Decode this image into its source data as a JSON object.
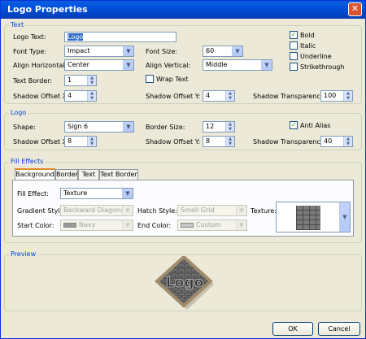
{
  "window": {
    "title": "Logo Properties",
    "close_glyph": "✕"
  },
  "text_group": {
    "label": "Text",
    "logo_text_label": "Logo Text:",
    "logo_text_value": "Logo",
    "font_type_label": "Font Type:",
    "font_type_value": "Impact",
    "font_size_label": "Font Size:",
    "font_size_value": "60",
    "align_horizontal_label": "Align Horizontal:",
    "align_horizontal_value": "Center",
    "align_vertical_label": "Align Vertical:",
    "align_vertical_value": "Middle",
    "text_border_label": "Text Border:",
    "text_border_value": "1",
    "wrap_text_label": "Wrap Text",
    "wrap_text_checked": false,
    "shadow_offset_x_label": "Shadow Offset X:",
    "shadow_offset_x_value": "4",
    "shadow_offset_y_label": "Shadow Offset Y:",
    "shadow_offset_y_value": "4",
    "shadow_transparency_label": "Shadow Transparency:",
    "shadow_transparency_value": "100",
    "bold_label": "Bold",
    "bold_checked": true,
    "italic_label": "Italic",
    "underline_label": "Underline",
    "strikethrough_label": "Strikethrough",
    "check_glyph": "✓"
  },
  "logo_group": {
    "label": "Logo",
    "shape_label": "Shape:",
    "shape_value": "Sign 6",
    "border_size_label": "Border Size:",
    "border_size_value": "12",
    "anti_alias_label": "Anti Alias",
    "anti_alias_checked": true,
    "shadow_offset_x_label": "Shadow Offset X:",
    "shadow_offset_x_value": "8",
    "shadow_offset_y_label": "Shadow Offset Y:",
    "shadow_offset_y_value": "8",
    "shadow_transparency_label": "Shadow Transparency:",
    "shadow_transparency_value": "40"
  },
  "fill_effects": {
    "label": "Fill Effects",
    "tabs": [
      "Background",
      "Border",
      "Text",
      "Text Border"
    ],
    "active_tab": "Background",
    "fill_effect_label": "Fill Effect:",
    "fill_effect_value": "Texture",
    "gradient_style_label": "Gradient Style:",
    "gradient_style_value": "Backward Diagonal",
    "hatch_style_label": "Hatch Style:",
    "hatch_style_value": "Small Grid",
    "texture_label": "Texture:",
    "start_color_label": "Start Color:",
    "start_color_value": "Navy",
    "end_color_label": "End Color:",
    "end_color_value": "Custom"
  },
  "preview": {
    "label": "Preview",
    "logo_text": "Logo"
  },
  "buttons": {
    "ok": "OK",
    "cancel": "Cancel"
  },
  "colors": {
    "title_bar": "#0054e3",
    "group_label": "#0046d5",
    "dialog_bg": "#ece9d8",
    "start_color_swatch": "#9a9a9a",
    "end_color_swatch": "#c8c8c8"
  },
  "icons": {
    "dropdown": "chevron-down-icon",
    "spin_up": "arrow-up-icon",
    "spin_down": "arrow-down-icon"
  }
}
